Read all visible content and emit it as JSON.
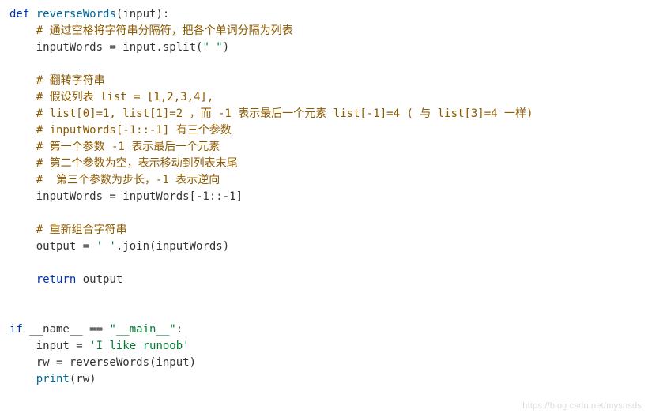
{
  "code": {
    "l1_kw": "def",
    "l1_fn": "reverseWords",
    "l1_rest": "(input):",
    "l2_cmt": "# 通过空格将字符串分隔符，把各个单词分隔为列表",
    "l3_a": "inputWords = input.split(",
    "l3_str": "\" \"",
    "l3_b": ")",
    "l5_cmt": "# 翻转字符串",
    "l6_cmt": "# 假设列表 list = [1,2,3,4],",
    "l7_cmt": "# list[0]=1, list[1]=2 ，而 -1 表示最后一个元素 list[-1]=4 ( 与 list[3]=4 一样)",
    "l8_cmt": "# inputWords[-1::-1] 有三个参数",
    "l9_cmt": "# 第一个参数 -1 表示最后一个元素",
    "l10_cmt": "# 第二个参数为空，表示移动到列表末尾",
    "l11_cmt": "#  第三个参数为步长，-1 表示逆向",
    "l12": "inputWords = inputWords[-1::-1]",
    "l14_cmt": "# 重新组合字符串",
    "l15_a": "output = ",
    "l15_str": "' '",
    "l15_b": ".join(inputWords)",
    "l17_kw": "return",
    "l17_rest": " output",
    "l20_kw": "if",
    "l20_a": " __name__ == ",
    "l20_str": "\"__main__\"",
    "l20_b": ":",
    "l21_a": "input = ",
    "l21_str": "'I like runoob'",
    "l22": "rw = reverseWords(input)",
    "l23_fn": "print",
    "l23_rest": "(rw)"
  },
  "watermark": "https://blog.csdn.net/mysnsds"
}
